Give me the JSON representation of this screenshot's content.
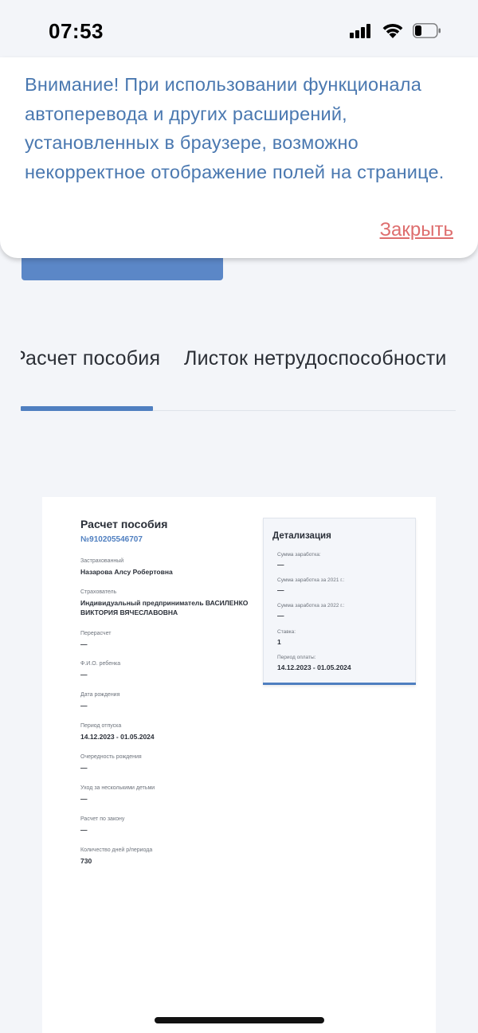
{
  "status_bar": {
    "time": "07:53"
  },
  "banner": {
    "text": "Внимание! При использовании функционала автоперевода и других расширений, установленных в браузере, возможно некорректное отображение полей на странице.",
    "close_label": "Закрыть"
  },
  "tabs": [
    {
      "label": "Расчет пособия",
      "active": true
    },
    {
      "label": "Листок нетрудоспособности",
      "active": false
    }
  ],
  "document": {
    "title": "Расчет пособия",
    "number": "№910205546707",
    "fields": [
      {
        "label": "Застрахованный",
        "value": "Назарова Алсу Робертовна"
      },
      {
        "label": "Страхователь",
        "value": "Индивидуальный предприниматель ВАСИЛЕНКО ВИКТОРИЯ ВЯЧЕСЛАВОВНА"
      },
      {
        "label": "Перерасчет",
        "value": "—"
      },
      {
        "label": "Ф.И.О. ребенка",
        "value": "—"
      },
      {
        "label": "Дата рождения",
        "value": "—"
      },
      {
        "label": "Период отпуска",
        "value": "14.12.2023 - 01.05.2024"
      },
      {
        "label": "Очередность рождения",
        "value": "—"
      },
      {
        "label": "Уход за несколькими детьми",
        "value": "—"
      },
      {
        "label": "Расчет по закону",
        "value": "—"
      },
      {
        "label": "Количество дней р/периода",
        "value": "730"
      }
    ],
    "details": {
      "title": "Детализация",
      "items": [
        {
          "label": "Сумма заработка:",
          "value": "—"
        },
        {
          "label": "Сумма заработка за 2021 г.:",
          "value": "—"
        },
        {
          "label": "Сумма заработка за 2022 г.:",
          "value": "—"
        },
        {
          "label": "Ставка:",
          "value": "1"
        },
        {
          "label": "Период оплаты:",
          "value": "14.12.2023 - 01.05.2024"
        }
      ]
    }
  }
}
